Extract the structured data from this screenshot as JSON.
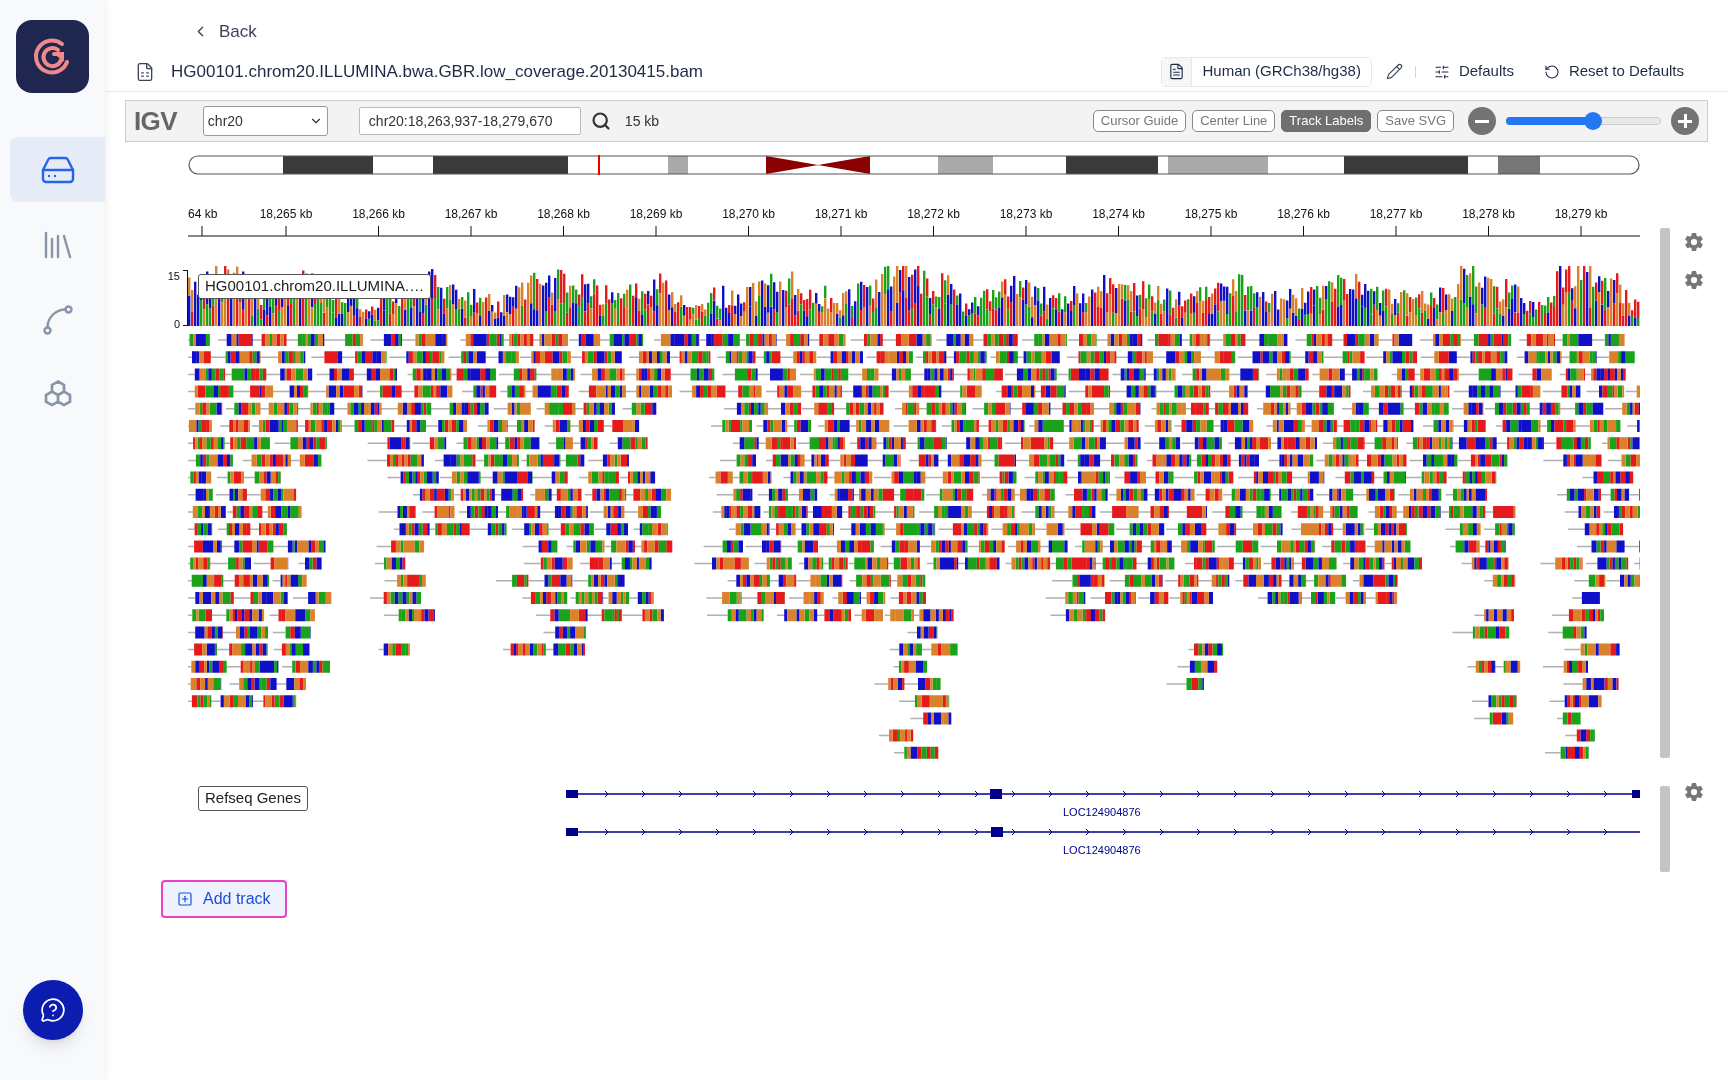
{
  "sidebar": {
    "items": [
      {
        "kind": "storage",
        "selected": true
      },
      {
        "kind": "library",
        "selected": false
      },
      {
        "kind": "graph",
        "selected": false
      },
      {
        "kind": "hexagons",
        "selected": false
      }
    ]
  },
  "header": {
    "back_label": "Back",
    "file_name": "HG00101.chrom20.ILLUMINA.bwa.GBR.low_coverage.20130415.bam",
    "genome": "Human (GRCh38/hg38)",
    "defaults_label": "Defaults",
    "reset_label": "Reset to Defaults"
  },
  "igv": {
    "logo": "IGV",
    "chromosome": "chr20",
    "locus": "chr20:18,263,937-18,279,670",
    "span": "15 kb",
    "toggles": [
      {
        "label": "Cursor Guide",
        "selected": false
      },
      {
        "label": "Center Line",
        "selected": false
      },
      {
        "label": "Track Labels",
        "selected": true
      }
    ],
    "save_label": "Save SVG",
    "zoom": {
      "level": 0.56
    },
    "ruler_labels": [
      "64 kb",
      "18,265 kb",
      "18,266 kb",
      "18,267 kb",
      "18,268 kb",
      "18,269 kb",
      "18,270 kb",
      "18,271 kb",
      "18,272 kb",
      "18,273 kb",
      "18,274 kb",
      "18,275 kb",
      "18,276 kb",
      "18,277 kb",
      "18,278 kb",
      "18,279 kb"
    ],
    "tracks": [
      {
        "kind": "alignment",
        "name": "HG00101.chrom20.ILLUMINA.…",
        "scale_max": "15",
        "scale_min": "0"
      },
      {
        "kind": "genes",
        "name": "Refseq Genes",
        "features": [
          "LOC124904876",
          "LOC124904876"
        ]
      }
    ]
  },
  "add_track": "Add track"
}
